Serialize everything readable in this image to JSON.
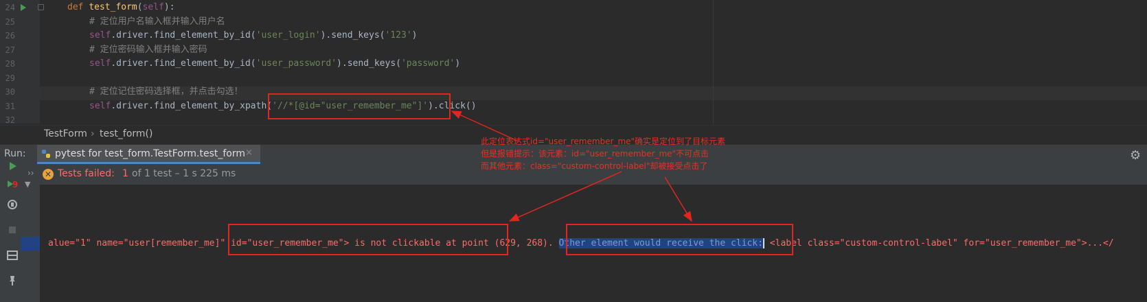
{
  "editor": {
    "line_numbers": [
      "24",
      "25",
      "26",
      "27",
      "28",
      "29",
      "30",
      "31",
      "32"
    ],
    "lines": [
      {
        "indent": 0,
        "tokens": [
          {
            "t": "def ",
            "c": "kw"
          },
          {
            "t": "test_form",
            "c": "fn"
          },
          {
            "t": "(",
            "c": "p"
          },
          {
            "t": "self",
            "c": "slf"
          },
          {
            "t": "):",
            "c": "p"
          }
        ]
      },
      {
        "indent": 1,
        "tokens": [
          {
            "t": "# 定位用户名输入框并输入用户名",
            "c": "cm"
          }
        ]
      },
      {
        "indent": 1,
        "tokens": [
          {
            "t": "self",
            "c": "slf"
          },
          {
            "t": ".driver.find_element_by_id(",
            "c": "p"
          },
          {
            "t": "'user_login'",
            "c": "str"
          },
          {
            "t": ").send_keys(",
            "c": "p"
          },
          {
            "t": "'123'",
            "c": "str"
          },
          {
            "t": ")",
            "c": "p"
          }
        ]
      },
      {
        "indent": 1,
        "tokens": [
          {
            "t": "# 定位密码输入框并输入密码",
            "c": "cm"
          }
        ]
      },
      {
        "indent": 1,
        "tokens": [
          {
            "t": "self",
            "c": "slf"
          },
          {
            "t": ".driver.find_element_by_id(",
            "c": "p"
          },
          {
            "t": "'user_password'",
            "c": "str"
          },
          {
            "t": ").send_keys(",
            "c": "p"
          },
          {
            "t": "'password'",
            "c": "str"
          },
          {
            "t": ")",
            "c": "p"
          }
        ]
      },
      {
        "indent": 0,
        "tokens": []
      },
      {
        "indent": 1,
        "tokens": [
          {
            "t": "# 定位记住密码选择框，并点击勾选！",
            "c": "cm"
          }
        ]
      },
      {
        "indent": 1,
        "tokens": [
          {
            "t": "self",
            "c": "slf"
          },
          {
            "t": ".driver.find_element_by_xpath(",
            "c": "p"
          },
          {
            "t": "'//*[@id=\"user_remember_me\"]'",
            "c": "str"
          },
          {
            "t": ").click()",
            "c": "p"
          }
        ]
      },
      {
        "indent": 0,
        "tokens": []
      }
    ]
  },
  "breadcrumb": {
    "class_name": "TestForm",
    "separator": "›",
    "method_name": "test_form()"
  },
  "run": {
    "label": "Run:",
    "tab_title": "pytest for test_form.TestForm.test_form",
    "close_glyph": "×",
    "gear_glyph": "⚙"
  },
  "status": {
    "fail_glyph": "✕",
    "failed_label": "Tests failed:",
    "failed_count": "1",
    "summary": "of 1 test – 1 s 225 ms"
  },
  "toolbar": {
    "rerun_failed_badge": "9",
    "expand_glyph": "››",
    "collapse_glyph": "▼"
  },
  "console": {
    "before": "alue=\"1\" name=\"user[remember_me]\" id=\"user_remember_me\"> is not clickable at point (629, 268). ",
    "selected": "Other element would receive the click:",
    "after": " <label class=\"custom-control-label\" for=\"user_remember_me\">...</"
  },
  "annotation": {
    "lines": [
      "此定位表达式id=\"user_remember_me\"确实是定位到了目标元素",
      "但是报错提示：该元素：id=\"user_remember_me\"不可点击",
      "而其他元素：class=\"custom-control-label\"却被接受点击了"
    ]
  },
  "colors": {
    "annotation": "#e0261f",
    "error_text": "#ff6b68",
    "selection": "#214283"
  }
}
